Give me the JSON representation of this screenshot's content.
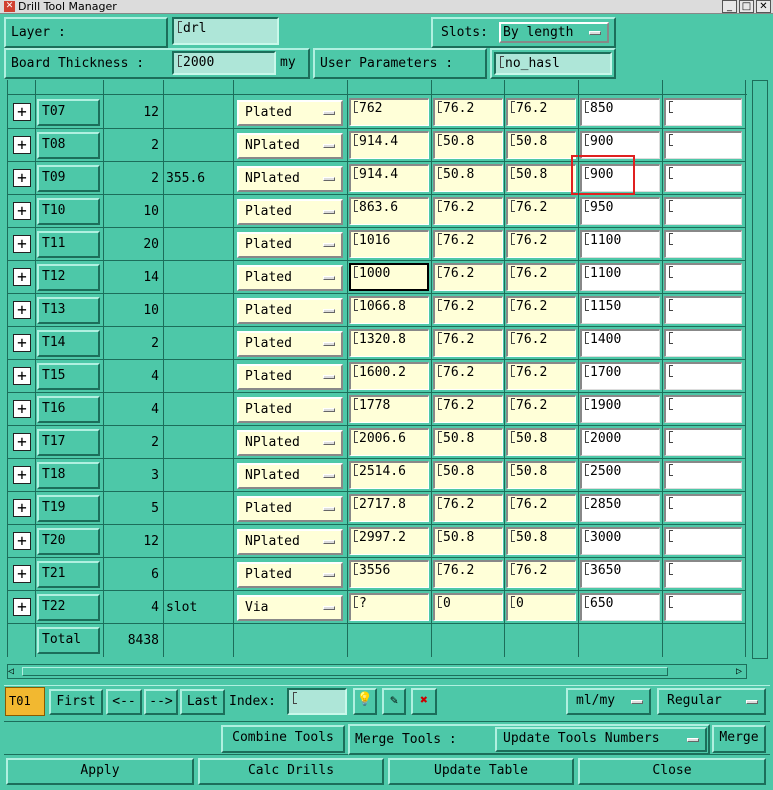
{
  "window": {
    "title": "Drill Tool Manager"
  },
  "header": {
    "layer_label": "Layer        :",
    "layer_value": "drl",
    "slots_label": "Slots:",
    "slots_value": "By length",
    "thickness_label": "Board Thickness :",
    "thickness_value": "2000",
    "thickness_unit": "my",
    "user_params_label": "User Parameters :",
    "user_params_value": "no_hasl"
  },
  "rows": [
    {
      "tool": "T07",
      "count": "12",
      "extra": "",
      "type": "Plated",
      "finish": "762",
      "min": "76.2",
      "max": "76.2",
      "drill": "850",
      "user": ""
    },
    {
      "tool": "T08",
      "count": "2",
      "extra": "",
      "type": "NPlated",
      "finish": "914.4",
      "min": "50.8",
      "max": "50.8",
      "drill": "900",
      "user": ""
    },
    {
      "tool": "T09",
      "count": "2",
      "extra": "355.6",
      "type": "NPlated",
      "finish": "914.4",
      "min": "50.8",
      "max": "50.8",
      "drill": "900",
      "user": ""
    },
    {
      "tool": "T10",
      "count": "10",
      "extra": "",
      "type": "Plated",
      "finish": "863.6",
      "min": "76.2",
      "max": "76.2",
      "drill": "950",
      "user": ""
    },
    {
      "tool": "T11",
      "count": "20",
      "extra": "",
      "type": "Plated",
      "finish": "1016",
      "min": "76.2",
      "max": "76.2",
      "drill": "1100",
      "user": ""
    },
    {
      "tool": "T12",
      "count": "14",
      "extra": "",
      "type": "Plated",
      "finish": "1000",
      "min": "76.2",
      "max": "76.2",
      "drill": "1100",
      "user": ""
    },
    {
      "tool": "T13",
      "count": "10",
      "extra": "",
      "type": "Plated",
      "finish": "1066.8",
      "min": "76.2",
      "max": "76.2",
      "drill": "1150",
      "user": ""
    },
    {
      "tool": "T14",
      "count": "2",
      "extra": "",
      "type": "Plated",
      "finish": "1320.8",
      "min": "76.2",
      "max": "76.2",
      "drill": "1400",
      "user": ""
    },
    {
      "tool": "T15",
      "count": "4",
      "extra": "",
      "type": "Plated",
      "finish": "1600.2",
      "min": "76.2",
      "max": "76.2",
      "drill": "1700",
      "user": ""
    },
    {
      "tool": "T16",
      "count": "4",
      "extra": "",
      "type": "Plated",
      "finish": "1778",
      "min": "76.2",
      "max": "76.2",
      "drill": "1900",
      "user": ""
    },
    {
      "tool": "T17",
      "count": "2",
      "extra": "",
      "type": "NPlated",
      "finish": "2006.6",
      "min": "50.8",
      "max": "50.8",
      "drill": "2000",
      "user": ""
    },
    {
      "tool": "T18",
      "count": "3",
      "extra": "",
      "type": "NPlated",
      "finish": "2514.6",
      "min": "50.8",
      "max": "50.8",
      "drill": "2500",
      "user": ""
    },
    {
      "tool": "T19",
      "count": "5",
      "extra": "",
      "type": "Plated",
      "finish": "2717.8",
      "min": "76.2",
      "max": "76.2",
      "drill": "2850",
      "user": ""
    },
    {
      "tool": "T20",
      "count": "12",
      "extra": "",
      "type": "NPlated",
      "finish": "2997.2",
      "min": "50.8",
      "max": "50.8",
      "drill": "3000",
      "user": ""
    },
    {
      "tool": "T21",
      "count": "6",
      "extra": "",
      "type": "Plated",
      "finish": "3556",
      "min": "76.2",
      "max": "76.2",
      "drill": "3650",
      "user": ""
    },
    {
      "tool": "T22",
      "count": "4",
      "extra": "slot",
      "type": "Via",
      "finish": "?",
      "min": "0",
      "max": "0",
      "drill": "650",
      "user": ""
    }
  ],
  "total": {
    "label": "Total",
    "value": "8438"
  },
  "nav": {
    "current_tool": "T01",
    "first": "First",
    "prev": "<--",
    "next": "-->",
    "last": "Last",
    "index_label": "Index:",
    "index_value": "",
    "units": "ml/my",
    "mode": "Regular"
  },
  "actions": {
    "combine": "Combine Tools",
    "merge_label": "Merge Tools :",
    "merge_option": "Update Tools Numbers",
    "merge": "Merge",
    "apply": "Apply",
    "calc": "Calc Drills",
    "update": "Update Table",
    "close": "Close"
  },
  "colors": {
    "background": "#4dc8a8",
    "field_yellow": "#ffffd8",
    "current_tool_bg": "#f2b830",
    "highlight": "#e02020"
  }
}
